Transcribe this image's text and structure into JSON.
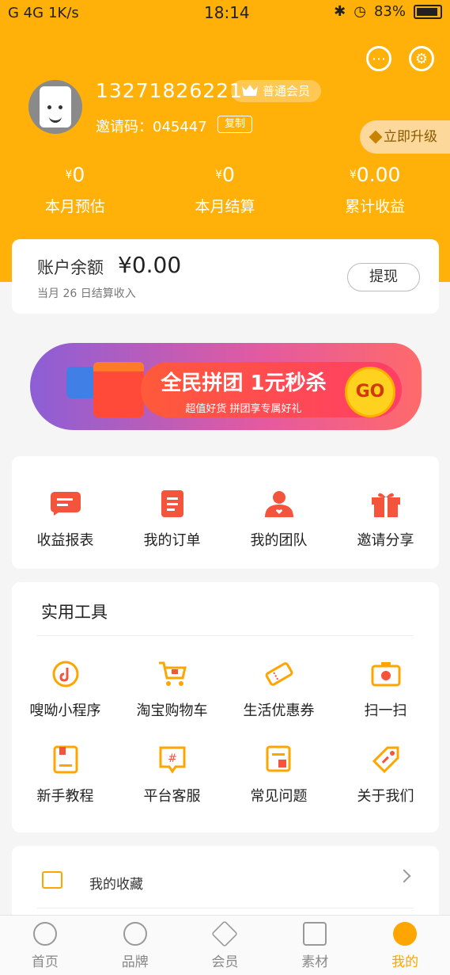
{
  "status_bar": {
    "signal": "G 4G",
    "speed": "1K/s",
    "time": "18:14",
    "battery": "83%"
  },
  "profile": {
    "phone": "13271826221",
    "member_level": "普通会员",
    "invite_label": "邀请码：",
    "invite_code": "045447",
    "copy_label": "复制",
    "upgrade_label": "立即升级"
  },
  "stats": [
    {
      "currency": "¥",
      "value": "0",
      "label": "本月预估"
    },
    {
      "currency": "¥",
      "value": "0",
      "label": "本月结算"
    },
    {
      "currency": "¥",
      "value": "0.00",
      "label": "累计收益"
    }
  ],
  "balance": {
    "label": "账户余额",
    "value": "¥0.00",
    "sub": "当月 26 日结算收入",
    "withdraw_label": "提现"
  },
  "banner": {
    "title": "全民拼团 1元秒杀",
    "subtitle": "超值好货 拼团享专属好礼",
    "go_label": "GO"
  },
  "quick_actions": [
    {
      "label": "收益报表",
      "icon": "report-icon"
    },
    {
      "label": "我的订单",
      "icon": "order-icon"
    },
    {
      "label": "我的团队",
      "icon": "team-icon"
    },
    {
      "label": "邀请分享",
      "icon": "gift-icon"
    }
  ],
  "tools": {
    "title": "实用工具",
    "items": [
      {
        "label": "嗖呦小程序",
        "icon": "mini-program-icon"
      },
      {
        "label": "淘宝购物车",
        "icon": "cart-icon"
      },
      {
        "label": "生活优惠券",
        "icon": "coupon-icon"
      },
      {
        "label": "扫一扫",
        "icon": "camera-icon"
      },
      {
        "label": "新手教程",
        "icon": "tutorial-icon"
      },
      {
        "label": "平台客服",
        "icon": "service-icon"
      },
      {
        "label": "常见问题",
        "icon": "faq-icon"
      },
      {
        "label": "关于我们",
        "icon": "tag-icon"
      }
    ]
  },
  "favorites": {
    "label": "我的收藏"
  },
  "tabbar": [
    {
      "label": "首页",
      "icon": "home-icon",
      "active": false
    },
    {
      "label": "品牌",
      "icon": "brand-icon",
      "active": false
    },
    {
      "label": "会员",
      "icon": "diamond-icon",
      "active": false
    },
    {
      "label": "素材",
      "icon": "material-icon",
      "active": false
    },
    {
      "label": "我的",
      "icon": "profile-icon",
      "active": true
    }
  ],
  "colors": {
    "brand": "#ffb10a",
    "accent": "#ffa500",
    "icon_red": "#f5543c"
  }
}
